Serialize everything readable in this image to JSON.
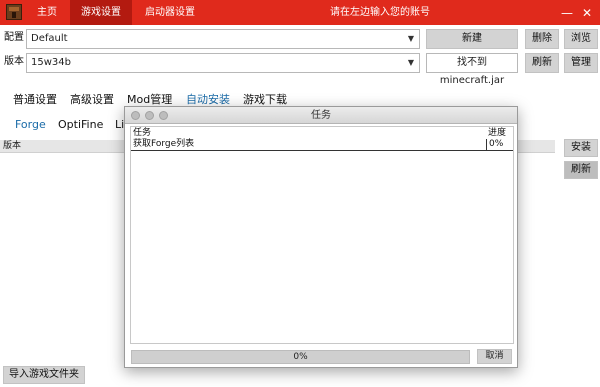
{
  "topbar": {
    "tabs": [
      {
        "label": "主页"
      },
      {
        "label": "游戏设置"
      },
      {
        "label": "启动器设置"
      }
    ],
    "account_prompt": "请在左边输入您的账号",
    "minimize": "—",
    "close": "✕",
    "accent": "#e02a1c"
  },
  "config": {
    "label": "配置",
    "value": "Default",
    "new_btn": "新建",
    "delete_btn": "删除",
    "browse_btn": "浏览"
  },
  "version": {
    "label": "版本",
    "value": "15w34b",
    "status": "找不到minecraft.jar",
    "refresh_btn": "刷新",
    "manage_btn": "管理"
  },
  "main_tabs": [
    {
      "label": "普通设置"
    },
    {
      "label": "高级设置"
    },
    {
      "label": "Mod管理"
    },
    {
      "label": "自动安装"
    },
    {
      "label": "游戏下载"
    }
  ],
  "sub_tabs": [
    {
      "label": "Forge"
    },
    {
      "label": "OptiFine"
    },
    {
      "label": "Li"
    }
  ],
  "list": {
    "header": "版本",
    "install_btn": "安装",
    "refresh_btn": "刷新"
  },
  "import_btn": "导入游戏文件夹",
  "dialog": {
    "title": "任务",
    "col_task": "任务",
    "col_progress": "进度",
    "rows": [
      {
        "task": "获取Forge列表",
        "progress": "0%"
      }
    ],
    "overall_progress": "0%",
    "cancel_btn": "取消"
  }
}
